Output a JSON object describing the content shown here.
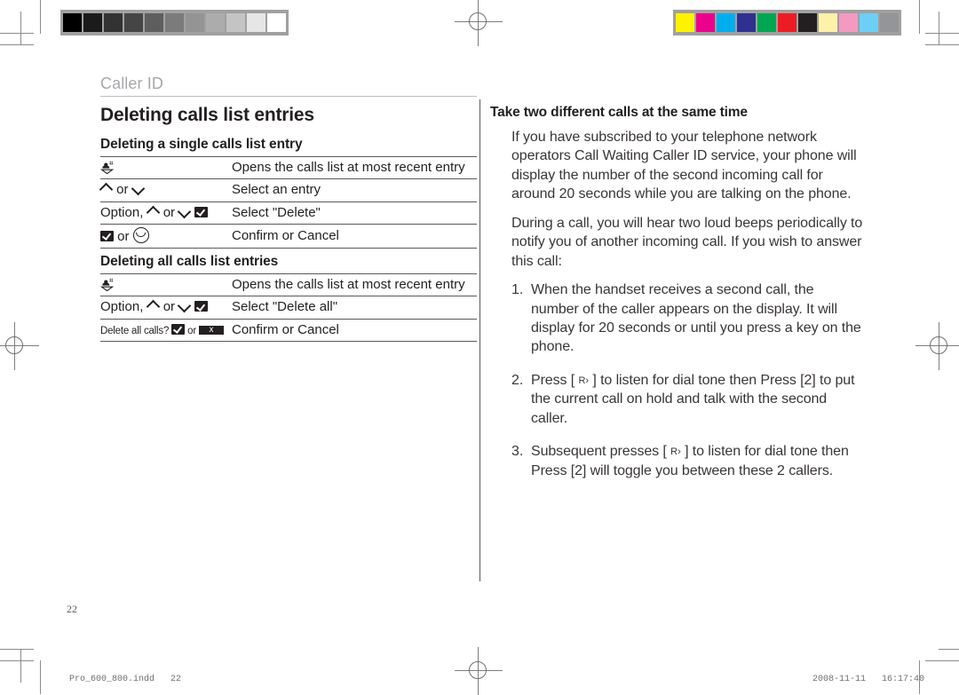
{
  "prepress": {
    "gray_bar_swatches": [
      "#000000",
      "#1b1b1b",
      "#333333",
      "#454545",
      "#5e5e5e",
      "#7b7b7b",
      "#949494",
      "#acacac",
      "#c4c4c4",
      "#e6e6e6",
      "#ffffff"
    ],
    "color_bar_swatches": [
      "#fff200",
      "#ec008c",
      "#00aeef",
      "#2e3192",
      "#00a651",
      "#ed1c24",
      "#231f20",
      "#fdf2a8",
      "#f49ac1",
      "#6dcff6",
      "#939598"
    ],
    "registration_mark_name": "registration-mark",
    "crop_mark_name": "crop-mark"
  },
  "page": {
    "running_head": "Caller ID",
    "page_number": "22",
    "slug_left": "Pro_600_800.indd   22",
    "slug_right": "2008-11-11   16:17:40"
  },
  "left_column": {
    "title": "Deleting calls list entries",
    "sections": [
      {
        "heading": "Deleting a single calls list entry",
        "rows": [
          {
            "key_parts": [
              {
                "type": "icon",
                "name": "calls-list-key-icon"
              }
            ],
            "description": "Opens the calls list at most recent entry"
          },
          {
            "key_parts": [
              {
                "type": "icon",
                "name": "up-arrow-key-icon"
              },
              {
                "type": "text",
                "value": " or "
              },
              {
                "type": "icon",
                "name": "down-arrow-key-icon"
              }
            ],
            "description": "Select an entry"
          },
          {
            "key_parts": [
              {
                "type": "text",
                "value": "Option, "
              },
              {
                "type": "icon",
                "name": "up-arrow-key-icon"
              },
              {
                "type": "text",
                "value": " or "
              },
              {
                "type": "icon",
                "name": "down-arrow-key-icon"
              },
              {
                "type": "text",
                "value": " "
              },
              {
                "type": "icon",
                "name": "ok-key-icon"
              }
            ],
            "description": "Select \"Delete\""
          },
          {
            "key_parts": [
              {
                "type": "icon",
                "name": "ok-key-icon"
              },
              {
                "type": "text",
                "value": " or "
              },
              {
                "type": "icon",
                "name": "hangup-key-icon"
              }
            ],
            "description": "Confirm or Cancel"
          }
        ]
      },
      {
        "heading": "Deleting all calls list entries",
        "rows": [
          {
            "key_parts": [
              {
                "type": "icon",
                "name": "calls-list-key-icon"
              }
            ],
            "description": "Opens the calls list at most recent entry"
          },
          {
            "key_parts": [
              {
                "type": "text",
                "value": "Option, "
              },
              {
                "type": "icon",
                "name": "up-arrow-key-icon"
              },
              {
                "type": "text",
                "value": " or "
              },
              {
                "type": "icon",
                "name": "down-arrow-key-icon"
              },
              {
                "type": "text",
                "value": " "
              },
              {
                "type": "icon",
                "name": "ok-key-icon"
              }
            ],
            "description": "Select \"Delete all\""
          },
          {
            "key_parts": [
              {
                "type": "prompt",
                "value": "Delete all calls?"
              },
              {
                "type": "icon",
                "name": "ok-key-icon"
              },
              {
                "type": "text",
                "value": " or "
              },
              {
                "type": "icon",
                "name": "cancel-key-icon"
              }
            ],
            "description": "Confirm or Cancel"
          }
        ]
      }
    ],
    "labels": {
      "row1_key": "calls list key",
      "row2_key": "up or down",
      "row3_key": "Option, up or down, OK",
      "row4_key": "OK or hang up",
      "row5_key": "calls list key",
      "row6_key": "Option, up or down, OK",
      "row7_key": "Delete all calls? OK or cancel",
      "prompt_delete_all": "Delete all calls?",
      "word_or": " or ",
      "word_option": "Option, ",
      "cancel_glyph_label": "x"
    }
  },
  "right_column": {
    "heading": "Take two different calls at the same time",
    "paragraphs": [
      "If you have subscribed to your telephone network operators Call Waiting Caller ID service, your phone will display the number of the second incoming call for around 20 seconds while you are talking on the phone.",
      "During a call, you will hear two loud beeps periodically to notify you of another incoming call. If you wish to answer this call:"
    ],
    "steps": [
      {
        "before": "When the handset receives a second call, the number of the caller appears on the display. It will display for 20 seconds or until you press a key on the phone.",
        "after": ""
      },
      {
        "before": "Press [ ",
        "key": "R›",
        "after": " ] to listen for dial tone then Press [2] to put the current call on hold and talk with the second caller."
      },
      {
        "before": "Subsequent presses [ ",
        "key": "R›",
        "after": " ] to listen for dial tone then Press [2] will toggle you between these 2 callers."
      }
    ]
  },
  "colors": {
    "text": "#231f20",
    "body_text": "#3a3537",
    "running_head": "#a6a8ab",
    "rule": "#58595b",
    "mark": "#7d7d7d"
  }
}
